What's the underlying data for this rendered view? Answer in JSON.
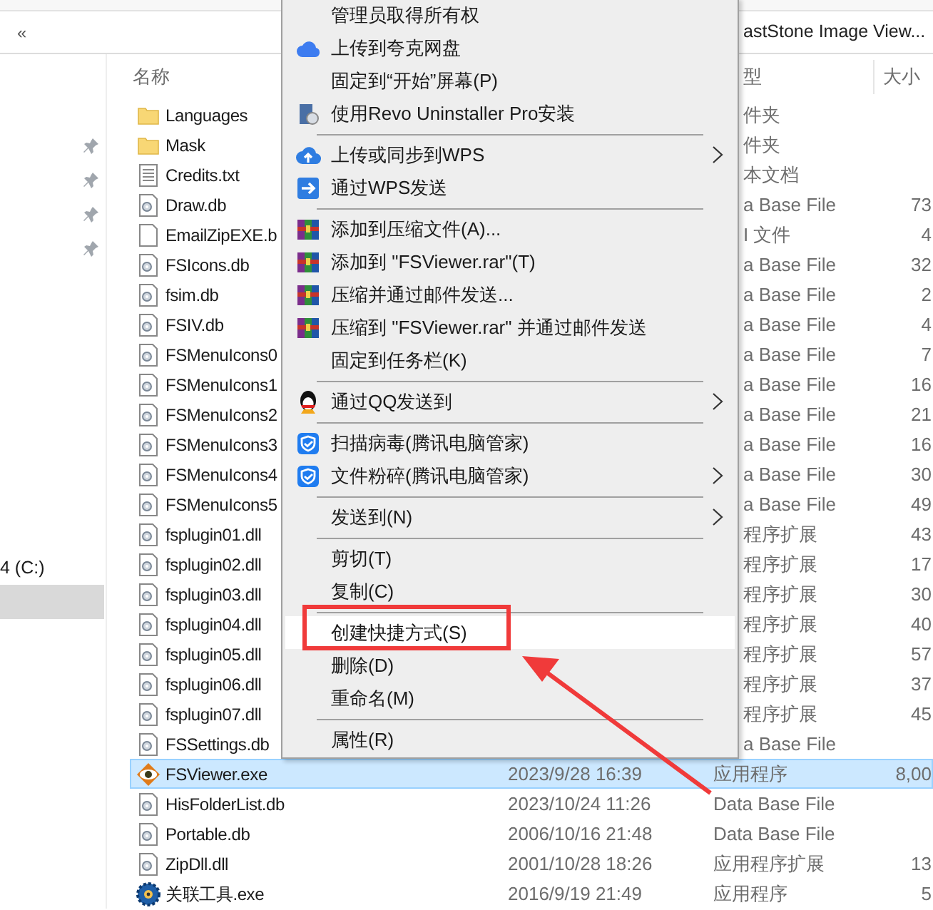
{
  "address_bar": {
    "chevron": "«",
    "path_tail": "astStone Image View..."
  },
  "nav": {
    "pinned": [
      {
        "pinned": true
      },
      {
        "pinned": true
      },
      {
        "pinned": true
      },
      {
        "pinned": true
      }
    ],
    "items": [
      {
        "label": "4 (C:)",
        "selected": false
      },
      {
        "selected": true
      }
    ]
  },
  "table": {
    "columns": [
      {
        "label": "名称"
      },
      {
        "label": "型"
      },
      {
        "label": "大小"
      }
    ],
    "rows": [
      {
        "kind": "folder",
        "name": "Languages",
        "type": "件夹",
        "selected": false
      },
      {
        "kind": "folder",
        "name": "Mask",
        "type": "件夹",
        "selected": false
      },
      {
        "kind": "text",
        "name": "Credits.txt",
        "type": "本文档",
        "selected": false
      },
      {
        "kind": "data",
        "name": "Draw.db",
        "type": "a Base File",
        "size": "73",
        "selected": false
      },
      {
        "kind": "blank",
        "name": "EmailZipEXE.b",
        "type": "I 文件",
        "size": "4",
        "selected": false
      },
      {
        "kind": "data",
        "name": "FSIcons.db",
        "type": "a Base File",
        "size": "32",
        "selected": false
      },
      {
        "kind": "data",
        "name": "fsim.db",
        "type": "a Base File",
        "size": "2",
        "selected": false
      },
      {
        "kind": "data",
        "name": "FSIV.db",
        "type": "a Base File",
        "size": "4",
        "selected": false
      },
      {
        "kind": "data",
        "name": "FSMenuIcons0",
        "type": "a Base File",
        "size": "7",
        "selected": false
      },
      {
        "kind": "data",
        "name": "FSMenuIcons1",
        "type": "a Base File",
        "size": "16",
        "selected": false
      },
      {
        "kind": "data",
        "name": "FSMenuIcons2",
        "type": "a Base File",
        "size": "21",
        "selected": false
      },
      {
        "kind": "data",
        "name": "FSMenuIcons3",
        "type": "a Base File",
        "size": "16",
        "selected": false
      },
      {
        "kind": "data",
        "name": "FSMenuIcons4",
        "type": "a Base File",
        "size": "30",
        "selected": false
      },
      {
        "kind": "data",
        "name": "FSMenuIcons5",
        "type": "a Base File",
        "size": "49",
        "selected": false
      },
      {
        "kind": "data",
        "name": "fsplugin01.dll",
        "type": "程序扩展",
        "size": "43",
        "selected": false
      },
      {
        "kind": "data",
        "name": "fsplugin02.dll",
        "type": "程序扩展",
        "size": "17",
        "selected": false
      },
      {
        "kind": "data",
        "name": "fsplugin03.dll",
        "type": "程序扩展",
        "size": "30",
        "selected": false
      },
      {
        "kind": "data",
        "name": "fsplugin04.dll",
        "type": "程序扩展",
        "size": "40",
        "selected": false
      },
      {
        "kind": "data",
        "name": "fsplugin05.dll",
        "type": "程序扩展",
        "size": "57",
        "selected": false
      },
      {
        "kind": "data",
        "name": "fsplugin06.dll",
        "type": "程序扩展",
        "size": "37",
        "selected": false
      },
      {
        "kind": "data",
        "name": "fsplugin07.dll",
        "type": "程序扩展",
        "size": "45",
        "selected": false
      },
      {
        "kind": "data",
        "name": "FSSettings.db",
        "type": "a Base File",
        "selected": false
      },
      {
        "kind": "viewer",
        "name": "FSViewer.exe",
        "date": "2023/9/28 16:39",
        "type": "应用程序",
        "size": "8,00",
        "selected": true
      },
      {
        "kind": "data",
        "name": "HisFolderList.db",
        "date": "2023/10/24 11:26",
        "type": "Data Base File",
        "selected": false
      },
      {
        "kind": "data",
        "name": "Portable.db",
        "date": "2006/10/16 21:48",
        "type": "Data Base File",
        "selected": false
      },
      {
        "kind": "data",
        "name": "ZipDll.dll",
        "date": "2001/10/28 18:26",
        "type": "应用程序扩展",
        "size": "13",
        "selected": false
      },
      {
        "kind": "tool",
        "name": "关联工具.exe",
        "date": "2016/9/19 21:49",
        "type": "应用程序",
        "size": "5",
        "selected": false
      }
    ]
  },
  "context_menu": {
    "items": [
      {
        "kind": "plain",
        "label": "管理员取得所有权",
        "selected": false
      },
      {
        "kind": "cloud",
        "label": "上传到夸克网盘",
        "selected": false
      },
      {
        "kind": "plain",
        "label": "固定到“开始”屏幕(P)",
        "selected": false
      },
      {
        "kind": "installer",
        "label": "使用Revo Uninstaller Pro安装",
        "selected": false
      },
      {
        "kind": "separator"
      },
      {
        "kind": "upload",
        "label": "上传或同步到WPS",
        "submenu": true,
        "selected": false
      },
      {
        "kind": "send",
        "label": "通过WPS发送",
        "selected": false
      },
      {
        "kind": "separator"
      },
      {
        "kind": "archive",
        "label": "添加到压缩文件(A)...",
        "selected": false
      },
      {
        "kind": "archive",
        "label": "添加到 \"FSViewer.rar\"(T)",
        "selected": false
      },
      {
        "kind": "archive",
        "label": "压缩并通过邮件发送...",
        "selected": false
      },
      {
        "kind": "archive",
        "label": "压缩到 \"FSViewer.rar\" 并通过邮件发送",
        "selected": false
      },
      {
        "kind": "plain",
        "label": "固定到任务栏(K)",
        "selected": false
      },
      {
        "kind": "separator"
      },
      {
        "kind": "penguin",
        "label": "通过QQ发送到",
        "submenu": true,
        "selected": false
      },
      {
        "kind": "separator"
      },
      {
        "kind": "shield",
        "label": "扫描病毒(腾讯电脑管家)",
        "selected": false
      },
      {
        "kind": "shield",
        "label": "文件粉碎(腾讯电脑管家)",
        "submenu": true,
        "selected": false
      },
      {
        "kind": "separator"
      },
      {
        "kind": "plain",
        "label": "发送到(N)",
        "submenu": true,
        "selected": false
      },
      {
        "kind": "separator"
      },
      {
        "kind": "plain",
        "label": "剪切(T)",
        "selected": false
      },
      {
        "kind": "plain",
        "label": "复制(C)",
        "selected": false
      },
      {
        "kind": "separator"
      },
      {
        "kind": "plain",
        "label": "创建快捷方式(S)",
        "selected": true,
        "annotated": true
      },
      {
        "kind": "plain",
        "label": "删除(D)",
        "selected": false
      },
      {
        "kind": "plain",
        "label": "重命名(M)",
        "selected": false
      },
      {
        "kind": "separator"
      },
      {
        "kind": "plain",
        "label": "属性(R)",
        "selected": false
      }
    ]
  }
}
